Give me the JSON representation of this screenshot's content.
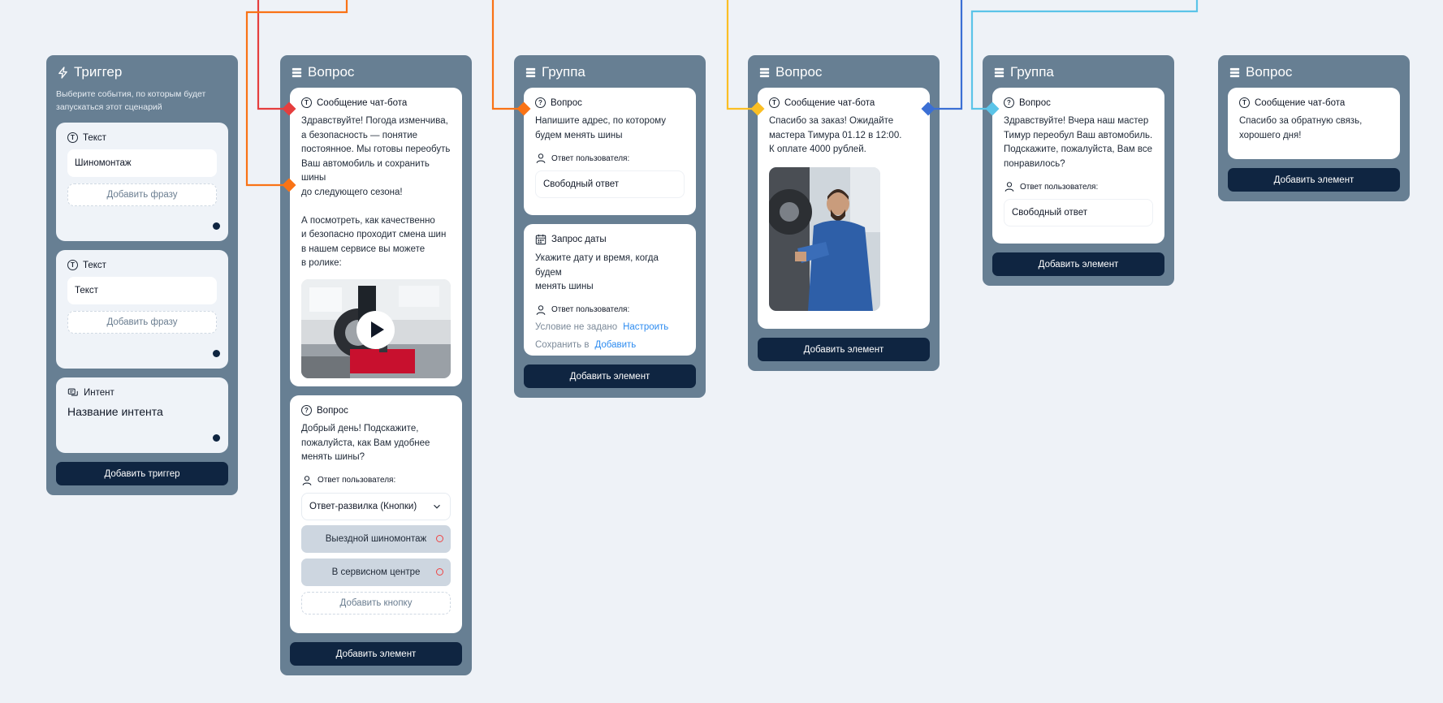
{
  "colors": {
    "canvas": "#eef2f7",
    "column": "#677f93",
    "card": "#eff3f8",
    "primary_button": "#0f2541",
    "link": "#2e8cf0",
    "wire_red": "#e53e3e",
    "wire_orange": "#f97316",
    "wire_yellow": "#fbbf24",
    "wire_blue": "#3b6fd4",
    "wire_light_blue": "#5bc4e8"
  },
  "icons": {
    "trigger": "lightning-icon",
    "block": "stack-icon",
    "text": "t-circle-icon",
    "question": "question-circle-icon",
    "user": "user-icon",
    "calendar": "calendar-icon",
    "intent": "chat-bubbles-icon",
    "dropdown": "chevron-down-icon",
    "play": "play-icon"
  },
  "trigger": {
    "title": "Триггер",
    "subtitle": "Выберите события, по которым будет запускаться этот сценарий",
    "text_card_1": {
      "label": "Текст",
      "value": "Шиномонтаж",
      "add_phrase": "Добавить фразу"
    },
    "text_card_2": {
      "label": "Текст",
      "placeholder": "Текст",
      "add_phrase": "Добавить фразу"
    },
    "intent_card": {
      "label": "Интент",
      "name": "Название интента"
    },
    "add_trigger": "Добавить  триггер"
  },
  "question1": {
    "title": "Вопрос",
    "message": {
      "label": "Сообщение чат-бота",
      "text": "Здравствуйте! Погода изменчива,\nа безопасность — понятие\nпостоянное. Мы  готовы переобуть\nВаш автомобиль и сохранить шины\nдо следующего сезона!\n\nА посмотреть, как качественно\nи безопасно проходит смена шин\nв нашем сервисе вы можете\nв ролике:"
    },
    "question": {
      "label": "Вопрос",
      "text": "Добрый день!  Подскажите,\nпожалуйста, как Вам удобнее\nменять шины?",
      "answer_label": "Ответ пользователя:",
      "answer_type": "Ответ-развилка (Кнопки)",
      "options": [
        "Выездной шиномонтаж",
        "В сервисном центре"
      ],
      "add_button": "Добавить кнопку"
    },
    "add_element": "Добавить элемент"
  },
  "group1": {
    "title": "Группа",
    "question": {
      "label": "Вопрос",
      "text": "Напишите адрес, по которому\nбудем менять шины",
      "answer_label": "Ответ пользователя:",
      "answer_value": "Свободный ответ"
    },
    "date_request": {
      "label": "Запрос даты",
      "text": "Укажите дату и время, когда будем\nменять шины",
      "answer_label": "Ответ пользователя:",
      "condition_text": "Условие не задано",
      "condition_link": "Настроить",
      "save_text": "Сохранить в",
      "save_link": "Добавить"
    },
    "add_element": "Добавить элемент"
  },
  "question2": {
    "title": "Вопрос",
    "message": {
      "label": "Сообщение чат-бота",
      "text": "Спасибо за заказ! Ожидайте\nмастера Тимура 01.12 в 12:00.\nК оплате 4000 рублей."
    },
    "add_element": "Добавить элемент"
  },
  "group2": {
    "title": "Группа",
    "question": {
      "label": "Вопрос",
      "text": "Здравствуйте! Вчера наш мастер\nТимур переобул Ваш автомобиль.\nПодскажите, пожалуйста, Вам все\nпонравилось?",
      "answer_label": "Ответ пользователя:",
      "answer_value": "Свободный ответ"
    },
    "add_element": "Добавить элемент"
  },
  "question3": {
    "title": "Вопрос",
    "message": {
      "label": "Сообщение чат-бота",
      "text": "Спасибо за обратную связь,\nхорошего дня!"
    },
    "add_element": "Добавить элемент"
  }
}
